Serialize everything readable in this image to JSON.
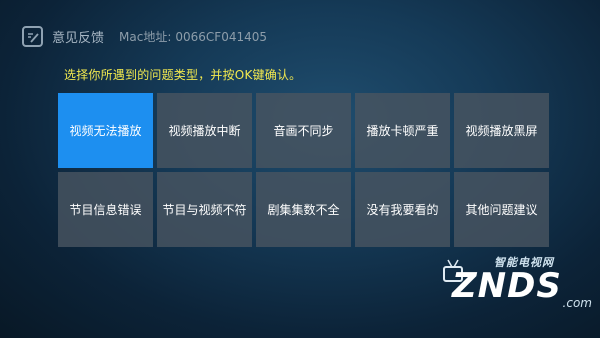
{
  "header": {
    "title": "意见反馈",
    "mac_label": "Mac地址:",
    "mac_value": "0066CF041405",
    "icon": "feedback-edit-icon"
  },
  "instruction": "选择你所遇到的问题类型，并按OK键确认。",
  "problem_types": [
    {
      "label": "视频无法播放",
      "selected": true
    },
    {
      "label": "视频播放中断",
      "selected": false
    },
    {
      "label": "音画不同步",
      "selected": false
    },
    {
      "label": "播放卡顿严重",
      "selected": false
    },
    {
      "label": "视频播放黑屏",
      "selected": false
    },
    {
      "label": "节目信息错误",
      "selected": false
    },
    {
      "label": "节目与视频不符",
      "selected": false
    },
    {
      "label": "剧集集数不全",
      "selected": false
    },
    {
      "label": "没有我要看的",
      "selected": false
    },
    {
      "label": "其他问题建议",
      "selected": false
    }
  ],
  "watermark": {
    "top": "智能电视网",
    "main": "ZNDS",
    "suffix": ".com"
  },
  "colors": {
    "selected_tile": "#1d8ff0",
    "tile": "#485460",
    "instruction_text": "#f2e94f"
  }
}
